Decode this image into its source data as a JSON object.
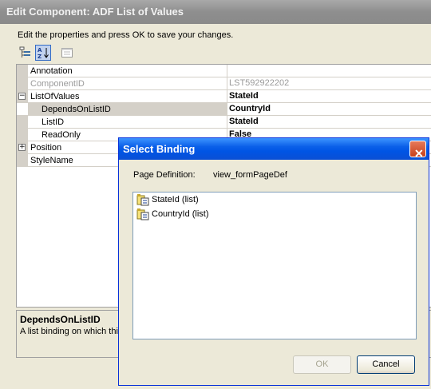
{
  "outer": {
    "title": "Edit Component: ADF List of Values",
    "instructions": "Edit the properties and press OK to save your changes."
  },
  "grid": {
    "rows": [
      {
        "name": "Annotation",
        "value": ""
      },
      {
        "name": "ComponentID",
        "value": "LST592922202"
      },
      {
        "name": "ListOfValues",
        "value": "StateId",
        "expander": "−"
      },
      {
        "name": "DependsOnListID",
        "value": "CountryId"
      },
      {
        "name": "ListID",
        "value": "StateId"
      },
      {
        "name": "ReadOnly",
        "value": "False"
      },
      {
        "name": "Position",
        "value": "",
        "expander": "+"
      },
      {
        "name": "StyleName",
        "value": ""
      }
    ]
  },
  "description": {
    "title": "DependsOnListID",
    "text": "A list binding on which this"
  },
  "modal": {
    "title": "Select Binding",
    "close_label": "✕",
    "page_definition_label": "Page Definition:",
    "page_definition_value": "view_formPageDef",
    "bindings": [
      {
        "label": "StateId (list)",
        "icon": "list-binding-icon"
      },
      {
        "label": "CountryId (list)",
        "icon": "list-binding-icon"
      }
    ],
    "ok_label": "OK",
    "cancel_label": "Cancel"
  }
}
